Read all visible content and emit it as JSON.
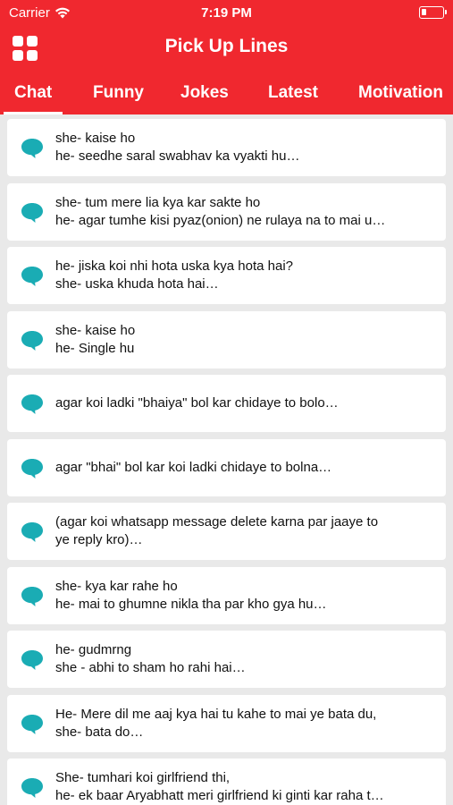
{
  "status": {
    "carrier": "Carrier",
    "time": "7:19 PM"
  },
  "header": {
    "title": "Pick Up Lines"
  },
  "tabs": [
    {
      "label": "Chat",
      "active": true
    },
    {
      "label": "Funny",
      "active": false
    },
    {
      "label": "Jokes",
      "active": false
    },
    {
      "label": "Latest",
      "active": false
    },
    {
      "label": "Motivation",
      "active": false
    }
  ],
  "colors": {
    "brand": "#f0282f",
    "chat_icon": "#1aacb4",
    "background": "#e9e9e9"
  },
  "items": [
    {
      "line1": "she- kaise ho",
      "line2": "he- seedhe saral swabhav ka vyakti hu…"
    },
    {
      "line1": "she- tum mere lia kya kar sakte ho",
      "line2": "he- agar tumhe kisi pyaz(onion) ne rulaya na to mai u…"
    },
    {
      "line1": "he- jiska koi nhi hota uska kya hota hai?",
      "line2": "she- uska khuda hota hai…"
    },
    {
      "line1": "she- kaise ho",
      "line2": "he- Single hu"
    },
    {
      "line1": "agar koi ladki \"bhaiya\" bol kar chidaye to bolo…",
      "line2": ""
    },
    {
      "line1": "agar \"bhai\" bol kar koi ladki chidaye to bolna…",
      "line2": ""
    },
    {
      "line1": "(agar koi whatsapp message delete karna par jaaye to",
      "line2": "ye reply kro)…"
    },
    {
      "line1": "she- kya kar rahe ho",
      "line2": "he- mai to ghumne nikla tha par kho gya hu…"
    },
    {
      "line1": "he- gudmrng",
      "line2": "she - abhi to sham ho rahi hai…"
    },
    {
      "line1": "He- Mere dil me aaj kya hai tu kahe to mai ye bata du,",
      "line2": "she- bata do…"
    },
    {
      "line1": "She- tumhari koi girlfriend thi,",
      "line2": "he- ek baar Aryabhatt meri girlfriend ki ginti kar raha t…"
    }
  ]
}
